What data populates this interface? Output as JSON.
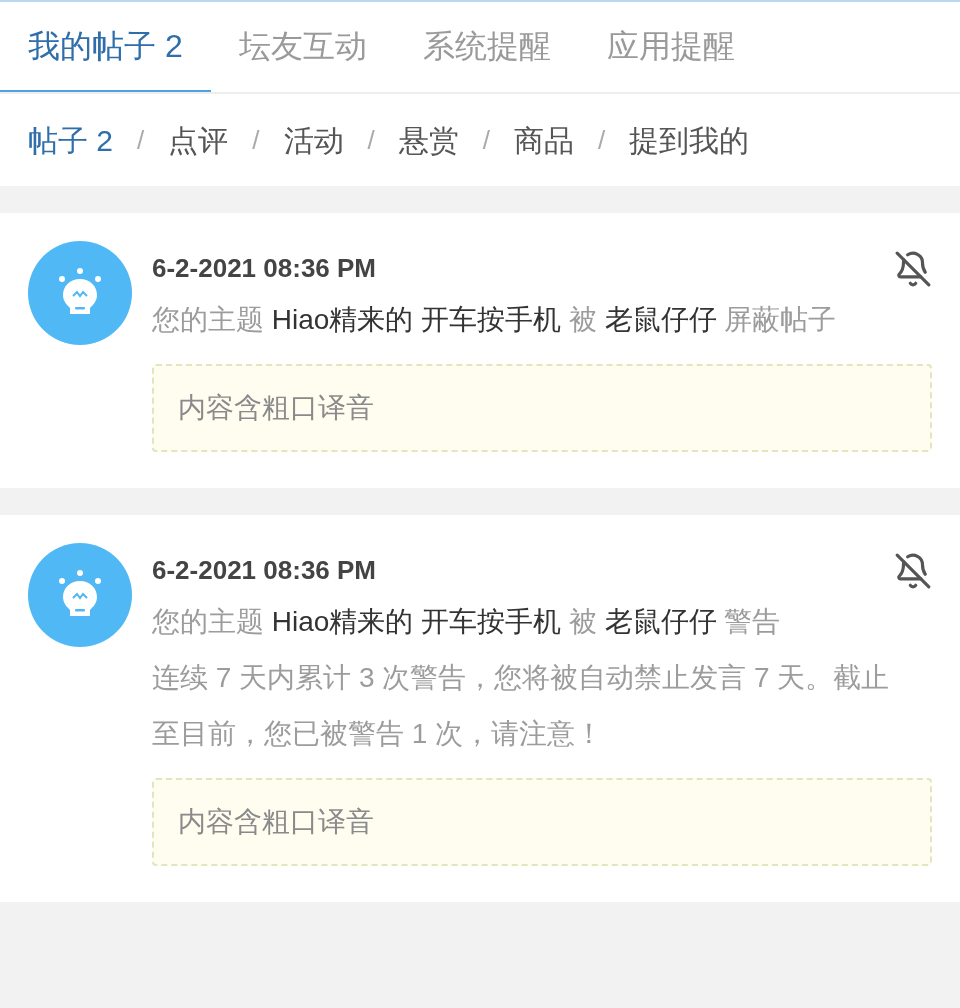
{
  "tabs": [
    {
      "label": "我的帖子 2",
      "selected": true
    },
    {
      "label": "坛友互动",
      "selected": false
    },
    {
      "label": "系统提醒",
      "selected": false
    },
    {
      "label": "应用提醒",
      "selected": false
    }
  ],
  "subtabs": [
    {
      "label": "帖子 2",
      "selected": true
    },
    {
      "label": "点评",
      "selected": false
    },
    {
      "label": "活动",
      "selected": false
    },
    {
      "label": "悬赏",
      "selected": false
    },
    {
      "label": "商品",
      "selected": false
    },
    {
      "label": "提到我的",
      "selected": false
    }
  ],
  "separator": "/",
  "notices": [
    {
      "time": "6-2-2021 08:36 PM",
      "muted": true,
      "parts": [
        {
          "text": "您的主题 ",
          "highlight": false
        },
        {
          "text": "Hiao精来的 开车按手机",
          "highlight": true
        },
        {
          "text": " 被 ",
          "highlight": false
        },
        {
          "text": "老鼠仔仔",
          "highlight": true
        },
        {
          "text": " 屏蔽帖子",
          "highlight": false
        }
      ],
      "reason": "内容含粗口译音"
    },
    {
      "time": "6-2-2021 08:36 PM",
      "muted": true,
      "parts": [
        {
          "text": "您的主题 ",
          "highlight": false
        },
        {
          "text": "Hiao精来的 开车按手机",
          "highlight": true
        },
        {
          "text": " 被 ",
          "highlight": false
        },
        {
          "text": "老鼠仔仔",
          "highlight": true
        },
        {
          "text": " 警告",
          "highlight": false
        }
      ],
      "detail": [
        "连续 7 天内累计 3 次警告，您将被自动禁止发言 7 天。截止至目前，您已被警告 1 次，请注意！"
      ],
      "reason": "内容含粗口译音"
    }
  ]
}
